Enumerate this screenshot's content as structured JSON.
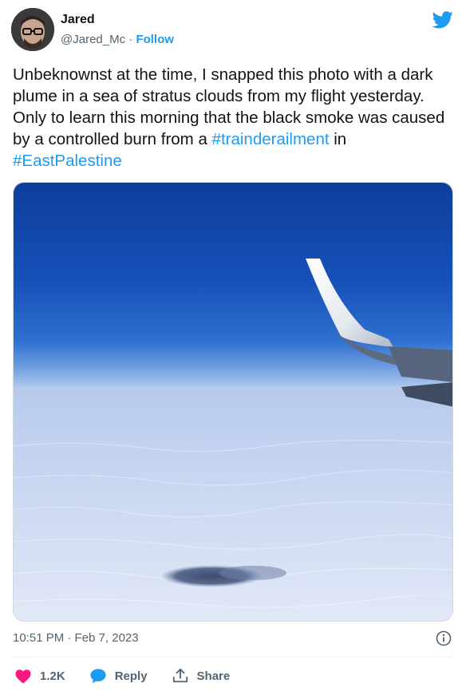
{
  "user": {
    "name": "Jared",
    "handle": "@Jared_Mc",
    "separator": "·",
    "follow_label": "Follow"
  },
  "tweet": {
    "text_parts": [
      "Unbeknownst at the time, I snapped this photo with a dark plume in a sea of stratus clouds from my flight yesterday. Only to learn this morning that the black smoke was caused by a controlled burn from a ",
      " in "
    ],
    "hashtags": [
      "#trainderailment",
      "#EastPalestine"
    ],
    "timestamp": "10:51 PM · Feb 7, 2023"
  },
  "actions": {
    "like_count": "1.2K",
    "reply_label": "Reply",
    "share_label": "Share"
  },
  "icons": {
    "brand": "twitter-bird-icon",
    "like": "heart-icon",
    "reply": "speech-bubble-icon",
    "share": "share-upload-icon",
    "info": "info-icon"
  },
  "colors": {
    "accent": "#1d9bf0",
    "like": "#f91880",
    "muted": "#536471"
  }
}
